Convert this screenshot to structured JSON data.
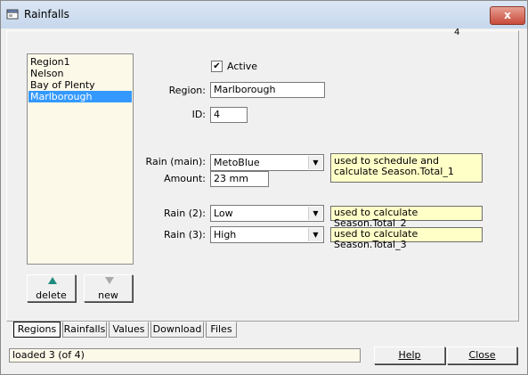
{
  "window": {
    "title": "Rainfalls",
    "close_glyph": "x"
  },
  "corner_mark": "4",
  "regions": {
    "items": [
      "Region1",
      "Nelson",
      "Bay of Plenty",
      "Marlborough"
    ],
    "selected_index": 3
  },
  "buttons": {
    "delete": "delete",
    "new": "new",
    "help": "Help",
    "close": "Close"
  },
  "form": {
    "active_label": "Active",
    "active_checked": true,
    "region_label": "Region:",
    "region_value": "Marlborough",
    "id_label": "ID:",
    "id_value": "4",
    "rain_main_label": "Rain (main):",
    "rain_main_value": "MetoBlue",
    "rain_main_note": "used to schedule and calculate Season.Total_1",
    "amount_label": "Amount:",
    "amount_value": "23 mm",
    "rain2_label": "Rain (2):",
    "rain2_value": "Low",
    "rain2_note": "used to calculate Season.Total_2",
    "rain3_label": "Rain (3):",
    "rain3_value": "High",
    "rain3_note": "used to calculate Season.Total_3"
  },
  "tabs": [
    "Regions",
    "Rainfalls",
    "Values",
    "Download",
    "Files"
  ],
  "active_tab": "Regions",
  "status": "loaded 3 (of 4)"
}
